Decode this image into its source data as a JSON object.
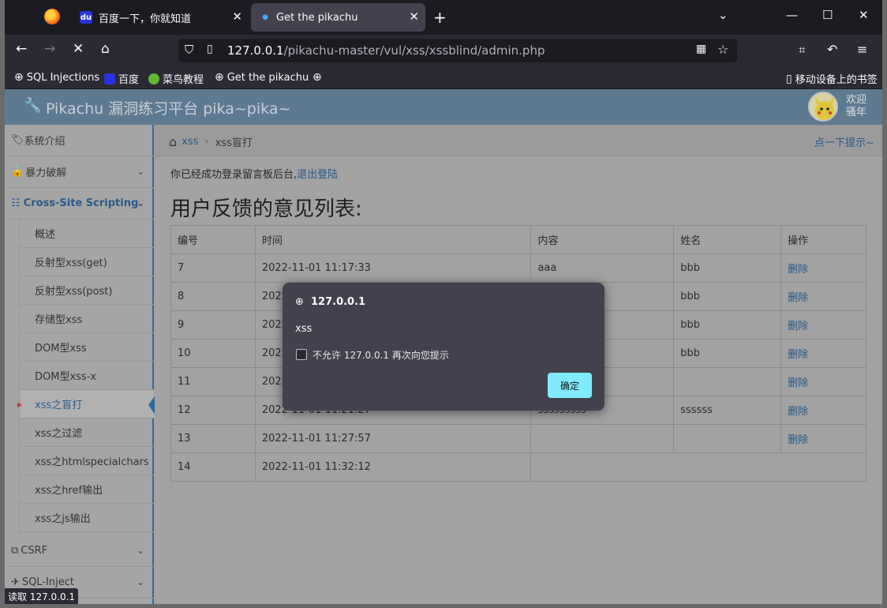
{
  "browser": {
    "tabs": [
      {
        "label": "百度一下，你就知道",
        "favicon": "baidu-icon"
      },
      {
        "label": "Get the pikachu",
        "favicon": "loading-dot-icon"
      }
    ],
    "url_host": "127.0.0.1",
    "url_path": "/pikachu-master/vul/xss/xssblind/admin.php",
    "bookmarks": [
      "SQL Injections",
      "百度",
      "菜鸟教程",
      "Get the pikachu"
    ],
    "mobile_bookmarks": "移动设备上的书签",
    "status_text": "读取 127.0.0.1"
  },
  "header": {
    "title": "Pikachu 漏洞练习平台 pika~pika~",
    "welcome_line1": "欢迎",
    "welcome_line2": "骚年"
  },
  "sidebar": {
    "sections": {
      "intro": "系统介绍",
      "brute": "暴力破解",
      "xss": "Cross-Site Scripting",
      "csrf": "CSRF",
      "sqli": "SQL-Inject"
    },
    "xss_items": [
      "概述",
      "反射型xss(get)",
      "反射型xss(post)",
      "存储型xss",
      "DOM型xss",
      "DOM型xss-x",
      "xss之盲打",
      "xss之过滤",
      "xss之htmlspecialchars",
      "xss之href输出",
      "xss之js输出"
    ]
  },
  "breadcrumb": {
    "root": "xss",
    "current": "xss盲打",
    "hint": "点一下提示~"
  },
  "main": {
    "logged_in_text": "你已经成功登录留言板后台,",
    "logout_link": "退出登陆",
    "heading": "用户反馈的意见列表:"
  },
  "table": {
    "headers": [
      "编号",
      "时间",
      "内容",
      "姓名",
      "操作"
    ],
    "rows": [
      {
        "id": "7",
        "time": "2022-11-01 11:17:33",
        "content": "aaa",
        "name": "bbb",
        "action": "删除"
      },
      {
        "id": "8",
        "time": "2022",
        "content": "",
        "name": "bbb",
        "action": "删除"
      },
      {
        "id": "9",
        "time": "2022",
        "content": "",
        "name": "bbb",
        "action": "删除"
      },
      {
        "id": "10",
        "time": "2022",
        "content": "",
        "name": "bbb",
        "action": "删除"
      },
      {
        "id": "11",
        "time": "2022",
        "content": "",
        "name": "",
        "action": "删除"
      },
      {
        "id": "12",
        "time": "2022-11-01 11:21:27",
        "content": "sssssssss",
        "name": "ssssss",
        "action": "删除"
      },
      {
        "id": "13",
        "time": "2022-11-01 11:27:57",
        "content": "",
        "name": "",
        "action": "删除"
      },
      {
        "id": "14",
        "time": "2022-11-01 11:32:12",
        "content": "",
        "name": "",
        "action": ""
      }
    ]
  },
  "dialog": {
    "origin": "127.0.0.1",
    "message": "xss",
    "checkbox_label": "不允许 127.0.0.1 再次向您提示",
    "ok_label": "确定"
  }
}
